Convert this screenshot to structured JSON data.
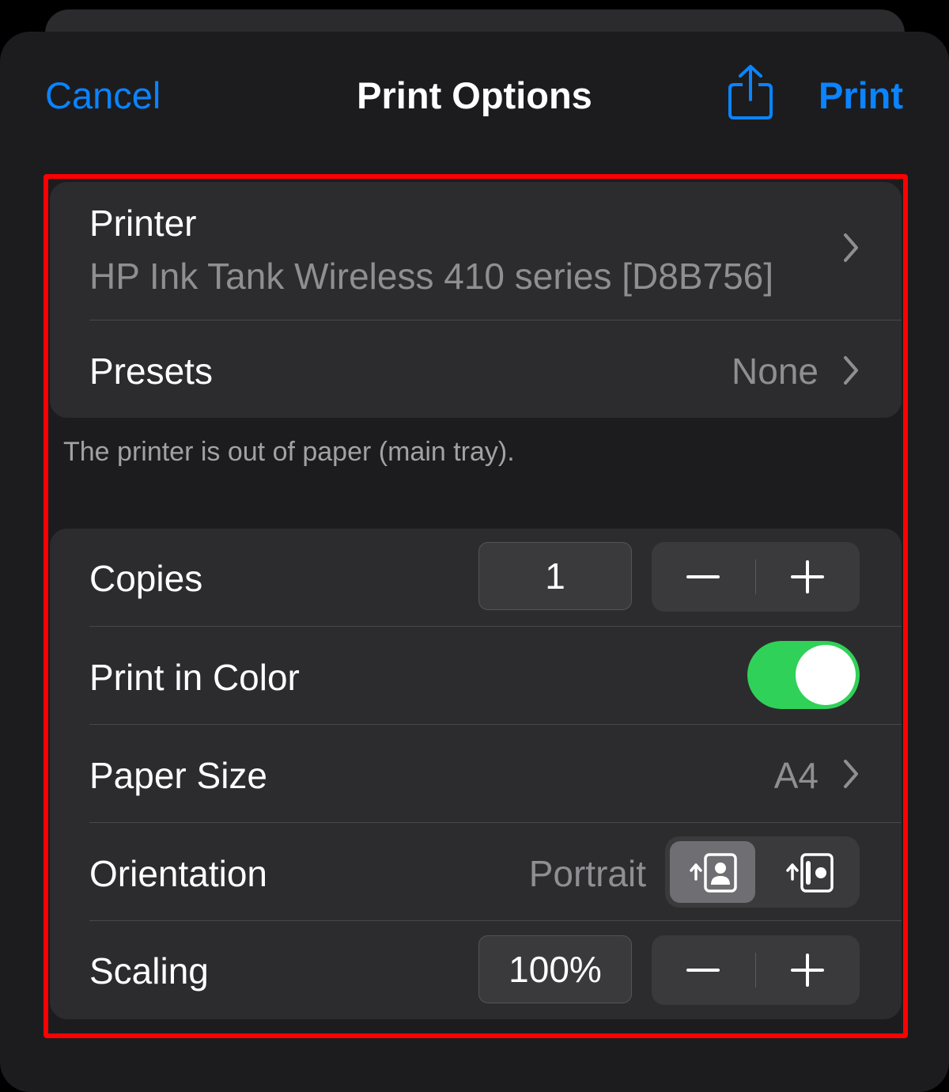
{
  "header": {
    "cancel_label": "Cancel",
    "title": "Print Options",
    "share_icon": "share-icon",
    "print_label": "Print"
  },
  "printer_group": {
    "printer_label": "Printer",
    "printer_name": "HP Ink Tank Wireless 410 series [D8B756]",
    "presets_label": "Presets",
    "presets_value": "None"
  },
  "status_message": "The printer is out of paper (main tray).",
  "options_group": {
    "copies_label": "Copies",
    "copies_value": "1",
    "print_in_color_label": "Print in Color",
    "print_in_color_on": true,
    "paper_size_label": "Paper Size",
    "paper_size_value": "A4",
    "orientation_label": "Orientation",
    "orientation_value": "Portrait",
    "orientation_options": [
      "portrait-icon",
      "landscape-icon"
    ],
    "scaling_label": "Scaling",
    "scaling_value": "100%"
  },
  "colors": {
    "accent": "#0a84ff",
    "toggle_on": "#30d158",
    "highlight": "#ff0000"
  }
}
